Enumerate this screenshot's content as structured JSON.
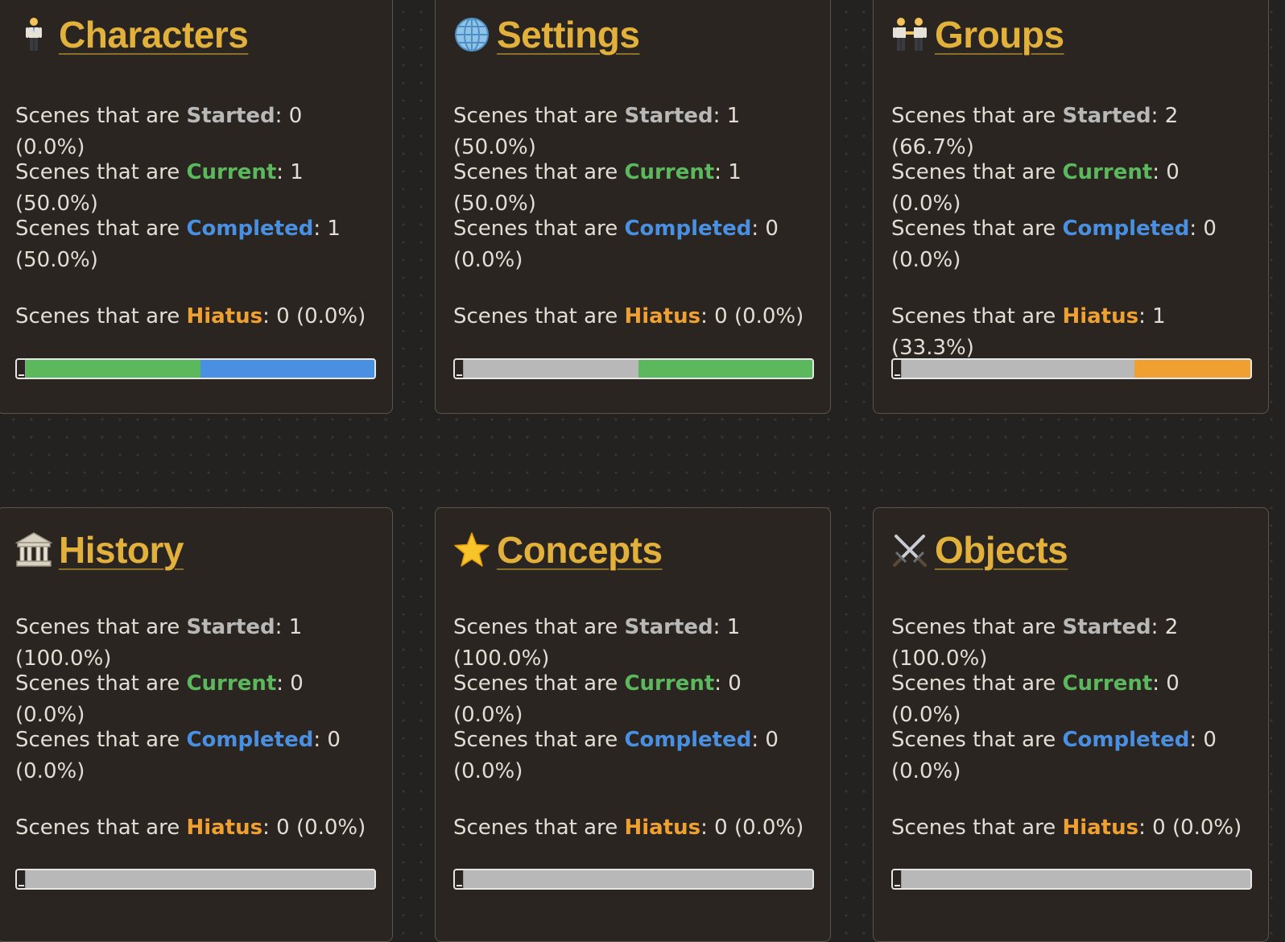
{
  "labels": {
    "prefix": "Scenes that are ",
    "started": "Started",
    "current": "Current",
    "completed": "Completed",
    "hiatus": "Hiatus"
  },
  "colors": {
    "title": "#e2b13c",
    "started": "#b8b8b8",
    "current": "#5cb85c",
    "completed": "#4a90e2",
    "hiatus": "#f0a030",
    "card_background": "#2a2520",
    "page_background": "#242220"
  },
  "cards": [
    {
      "title": "Characters",
      "icon": "standing-person-icon",
      "stats": {
        "started": ": 0 (0.0%)",
        "current": ": 1 (50.0%)",
        "completed": ": 1 (50.0%)",
        "hiatus": ": 0 (0.0%)"
      },
      "progress": {
        "started": 0.0,
        "current": 50.0,
        "completed": 50.0,
        "hiatus": 0.0
      }
    },
    {
      "title": "Settings",
      "icon": "globe-with-meridians-icon",
      "stats": {
        "started": ": 1 (50.0%)",
        "current": ": 1 (50.0%)",
        "completed": ": 0 (0.0%)",
        "hiatus": ": 0 (0.0%)"
      },
      "progress": {
        "started": 50.0,
        "current": 50.0,
        "completed": 0.0,
        "hiatus": 0.0
      }
    },
    {
      "title": "Groups",
      "icon": "people-holding-hands-icon",
      "stats": {
        "started": ": 2 (66.7%)",
        "current": ": 0 (0.0%)",
        "completed": ": 0 (0.0%)",
        "hiatus": ": 1 (33.3%)"
      },
      "progress": {
        "started": 66.7,
        "current": 0.0,
        "completed": 0.0,
        "hiatus": 33.3
      }
    },
    {
      "title": "History",
      "icon": "classical-building-icon",
      "stats": {
        "started": ": 1 (100.0%)",
        "current": ": 0 (0.0%)",
        "completed": ": 0 (0.0%)",
        "hiatus": ": 0 (0.0%)"
      },
      "progress": {
        "started": 100.0,
        "current": 0.0,
        "completed": 0.0,
        "hiatus": 0.0
      }
    },
    {
      "title": "Concepts",
      "icon": "star-icon",
      "stats": {
        "started": ": 1 (100.0%)",
        "current": ": 0 (0.0%)",
        "completed": ": 0 (0.0%)",
        "hiatus": ": 0 (0.0%)"
      },
      "progress": {
        "started": 100.0,
        "current": 0.0,
        "completed": 0.0,
        "hiatus": 0.0
      }
    },
    {
      "title": "Objects",
      "icon": "crossed-swords-icon",
      "stats": {
        "started": ": 2 (100.0%)",
        "current": ": 0 (0.0%)",
        "completed": ": 0 (0.0%)",
        "hiatus": ": 0 (0.0%)"
      },
      "progress": {
        "started": 100.0,
        "current": 0.0,
        "completed": 0.0,
        "hiatus": 0.0
      }
    }
  ]
}
